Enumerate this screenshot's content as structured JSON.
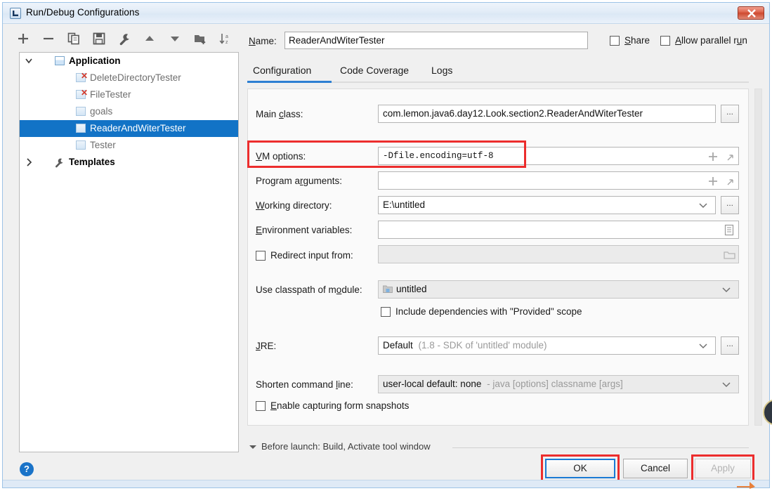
{
  "window": {
    "title": "Run/Debug Configurations",
    "icon": "idea-app-icon",
    "close_label": "×"
  },
  "toolbar": {
    "buttons": [
      {
        "name": "add-button",
        "icon": "plus-icon"
      },
      {
        "name": "remove-button",
        "icon": "minus-icon"
      },
      {
        "name": "copy-button",
        "icon": "copy-icon"
      },
      {
        "name": "save-button",
        "icon": "save-icon"
      },
      {
        "name": "edit-templates-button",
        "icon": "wrench-icon"
      },
      {
        "name": "move-up-button",
        "icon": "arrow-up-icon"
      },
      {
        "name": "move-down-button",
        "icon": "arrow-down-icon"
      },
      {
        "name": "new-folder-button",
        "icon": "folder-add-icon"
      },
      {
        "name": "sort-button",
        "icon": "sort-az-icon"
      }
    ]
  },
  "tree": {
    "nodes": [
      {
        "label": "Application",
        "level": 0,
        "icon": "application-icon",
        "expanded": true,
        "selected": false,
        "error": false
      },
      {
        "label": "DeleteDirectoryTester",
        "level": 1,
        "icon": "config-icon",
        "selected": false,
        "error": true
      },
      {
        "label": "FileTester",
        "level": 1,
        "icon": "config-icon",
        "selected": false,
        "error": true
      },
      {
        "label": "goals",
        "level": 1,
        "icon": "config-icon",
        "selected": false,
        "error": false
      },
      {
        "label": "ReaderAndWiterTester",
        "level": 1,
        "icon": "config-icon",
        "selected": true,
        "error": false
      },
      {
        "label": "Tester",
        "level": 1,
        "icon": "config-icon",
        "selected": false,
        "error": false
      },
      {
        "label": "Templates",
        "level": 0,
        "icon": "wrench-icon",
        "expanded": false,
        "selected": false,
        "error": false
      }
    ]
  },
  "header": {
    "name_label": "Name:",
    "name_value": "ReaderAndWiterTester",
    "share_label": "Share",
    "share_checked": false,
    "parallel_label": "Allow parallel run",
    "parallel_checked": false
  },
  "tabs": {
    "items": [
      {
        "label": "Configuration",
        "active": true
      },
      {
        "label": "Code Coverage",
        "active": false
      },
      {
        "label": "Logs",
        "active": false
      }
    ]
  },
  "form": {
    "main_class": {
      "label": "Main class:",
      "value": "com.lemon.java6.day12.Look.section2.ReaderAndWiterTester",
      "browse_label": "..."
    },
    "vm_options": {
      "label": "VM options:",
      "value": "-Dfile.encoding=utf-8",
      "expand_icon": "expand-icon",
      "add_icon": "plus-icon"
    },
    "program_arguments": {
      "label": "Program arguments:",
      "value": "",
      "expand_icon": "expand-icon",
      "add_icon": "plus-icon"
    },
    "working_directory": {
      "label": "Working directory:",
      "value": "E:\\untitled",
      "browse_label": "..."
    },
    "environment_variables": {
      "label": "Environment variables:",
      "value": "",
      "browse_icon": "list-icon"
    },
    "redirect_input": {
      "label": "Redirect input from:",
      "checked": false,
      "value": "",
      "browse_icon": "folder-icon"
    },
    "classpath_module": {
      "label": "Use classpath of module:",
      "value": "untitled",
      "icon": "module-icon"
    },
    "include_dependencies": {
      "label": "Include dependencies with \"Provided\" scope",
      "checked": false
    },
    "jre": {
      "label": "JRE:",
      "value": "Default",
      "value_hint": "(1.8 - SDK of 'untitled' module)",
      "browse_label": "..."
    },
    "shorten_command_line": {
      "label": "Shorten command line:",
      "value": "user-local default: none",
      "value_hint": "- java [options] classname [args]"
    },
    "form_snapshots": {
      "label": "Enable capturing form snapshots",
      "checked": false
    }
  },
  "before_launch": {
    "label": "Before launch: Build, Activate tool window",
    "expanded": true
  },
  "footer": {
    "help_label": "?",
    "ok_label": "OK",
    "cancel_label": "Cancel",
    "apply_label": "Apply",
    "apply_disabled": true
  },
  "annotations": {
    "highlight_color": "#ec2d2d",
    "boxes": [
      {
        "name": "vm-options-highlight"
      },
      {
        "name": "ok-button-highlight"
      },
      {
        "name": "apply-button-highlight"
      }
    ]
  },
  "colors": {
    "selection_blue": "#1273c6",
    "tab_accent": "#2d7fd3",
    "focus_blue": "#1a7ad4",
    "error_red": "#d33a2c"
  }
}
